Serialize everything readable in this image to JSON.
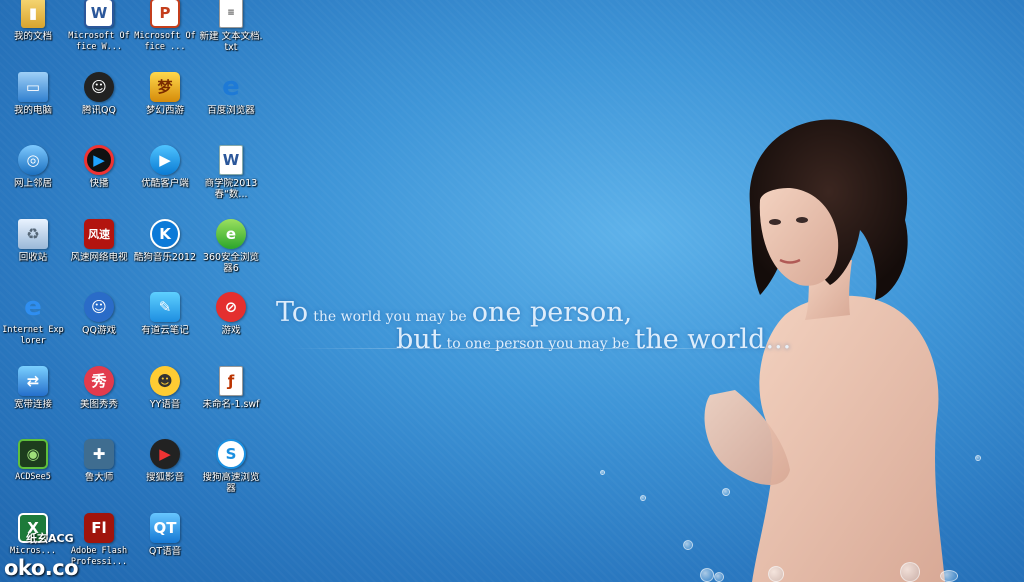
{
  "desktop": {
    "icons": [
      {
        "label": "我的文档",
        "glyph": "▮",
        "style": "c-docs",
        "name": "my-documents-icon"
      },
      {
        "label": "Microsoft Office W...",
        "glyph": "W",
        "style": "c-word",
        "name": "word-icon",
        "mono": true
      },
      {
        "label": "Microsoft Office ...",
        "glyph": "P",
        "style": "c-ppt",
        "name": "powerpoint-icon",
        "mono": true
      },
      {
        "label": "新建 文本文档.txt",
        "glyph": "≡",
        "style": "c-txt",
        "name": "text-file-icon"
      },
      {
        "label": "我的电脑",
        "glyph": "▭",
        "style": "c-pc",
        "name": "my-computer-icon"
      },
      {
        "label": "腾讯QQ",
        "glyph": "☺",
        "style": "c-qq",
        "name": "qq-icon"
      },
      {
        "label": "梦幻西游",
        "glyph": "梦",
        "style": "c-mh",
        "name": "game-menghuan-icon"
      },
      {
        "label": "百度浏览器",
        "glyph": "e",
        "style": "c-ie",
        "name": "baidu-browser-icon"
      },
      {
        "label": "网上邻居",
        "glyph": "◎",
        "style": "c-net",
        "name": "network-places-icon"
      },
      {
        "label": "快播",
        "glyph": "▶",
        "style": "c-kb",
        "name": "qvod-player-icon"
      },
      {
        "label": "优酷客户端",
        "glyph": "▶",
        "style": "c-youku",
        "name": "youku-client-icon"
      },
      {
        "label": "商学院2013春“数...",
        "glyph": "W",
        "style": "c-doc2",
        "name": "word-document-icon"
      },
      {
        "label": "回收站",
        "glyph": "♻",
        "style": "c-bin",
        "name": "recycle-bin-icon"
      },
      {
        "label": "风速网络电视",
        "glyph": "风速",
        "style": "c-fs",
        "name": "fengsu-tv-icon"
      },
      {
        "label": "酷狗音乐2012",
        "glyph": "K",
        "style": "c-kg",
        "name": "kugou-music-icon"
      },
      {
        "label": "360安全浏览器6",
        "glyph": "e",
        "style": "c-360",
        "name": "360-browser-icon"
      },
      {
        "label": "Internet Explorer",
        "glyph": "e",
        "style": "c-ie2",
        "name": "internet-explorer-icon",
        "mono": true
      },
      {
        "label": "QQ游戏",
        "glyph": "☺",
        "style": "c-qqgame",
        "name": "qq-game-icon"
      },
      {
        "label": "有道云笔记",
        "glyph": "✎",
        "style": "c-ynote",
        "name": "youdao-note-icon"
      },
      {
        "label": "游戏",
        "glyph": "⊘",
        "style": "c-game",
        "name": "games-icon"
      },
      {
        "label": "宽带连接",
        "glyph": "⇄",
        "style": "c-bb",
        "name": "broadband-connection-icon"
      },
      {
        "label": "美图秀秀",
        "glyph": "秀",
        "style": "c-mt",
        "name": "meitu-icon"
      },
      {
        "label": "YY语音",
        "glyph": "☻",
        "style": "c-yy",
        "name": "yy-voice-icon"
      },
      {
        "label": "未命名-1.swf",
        "glyph": "ƒ",
        "style": "c-swf",
        "name": "swf-file-icon"
      },
      {
        "label": "ACDSee5",
        "glyph": "◉",
        "style": "c-acd",
        "name": "acdsee-icon",
        "mono": true
      },
      {
        "label": "鲁大师",
        "glyph": "✚",
        "style": "c-lds",
        "name": "ludashi-icon"
      },
      {
        "label": "搜狐影音",
        "glyph": "▶",
        "style": "c-sh",
        "name": "sohu-video-icon"
      },
      {
        "label": "搜狗高速浏览器",
        "glyph": "S",
        "style": "c-sg",
        "name": "sogou-browser-icon"
      },
      {
        "label": "Micros...",
        "glyph": "X",
        "style": "c-xls",
        "name": "excel-icon",
        "mono": true
      },
      {
        "label": "Adobe Flash Professi...",
        "glyph": "Fl",
        "style": "c-fl",
        "name": "adobe-flash-icon",
        "mono": true
      },
      {
        "label": "QT语音",
        "glyph": "QT",
        "style": "c-qt",
        "name": "qt-voice-icon"
      }
    ]
  },
  "wallpaper": {
    "quote": {
      "l1_a": "To",
      "l1_b": "the world you may be",
      "l1_c": "one person,",
      "l2_a": "but",
      "l2_b": "to one person you may be",
      "l2_c": "the world..."
    },
    "watermark_small": "纸玄ACG",
    "watermark_big": "oko.co"
  }
}
